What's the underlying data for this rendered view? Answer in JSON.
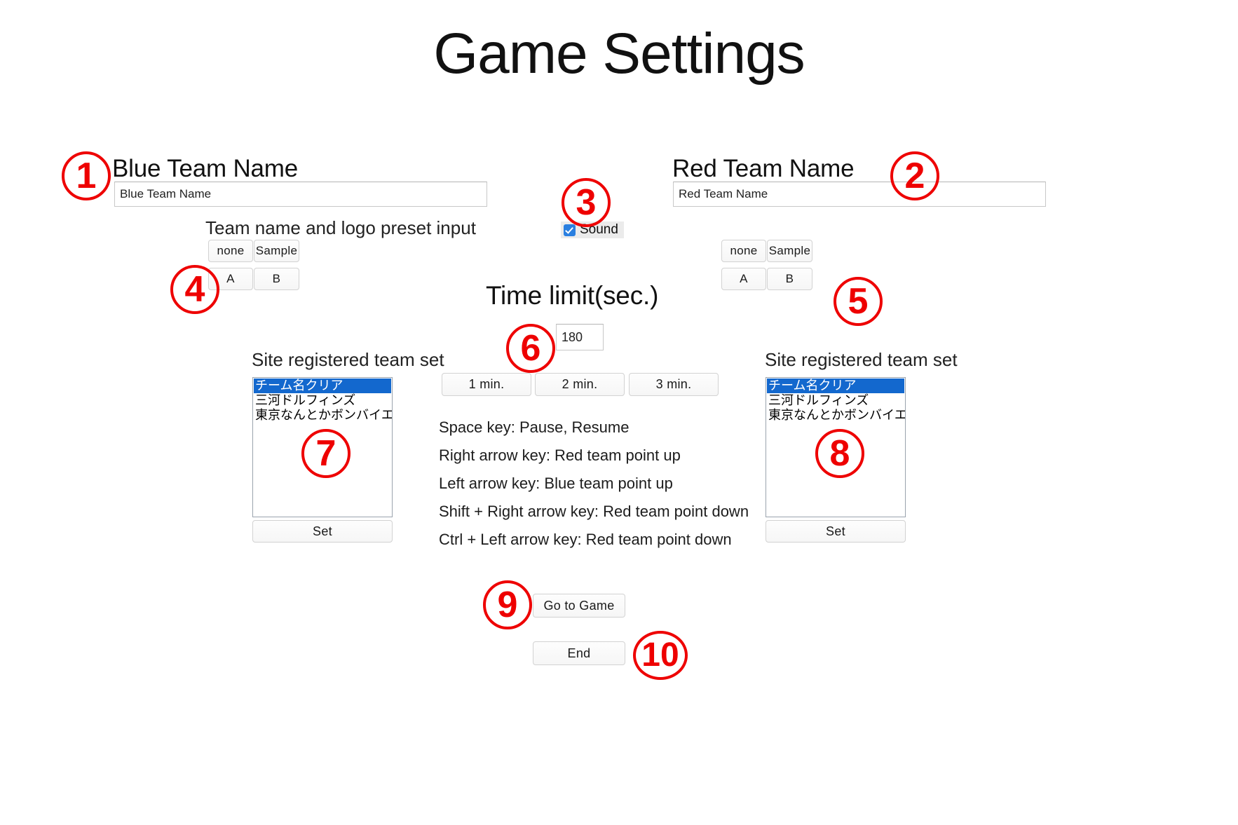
{
  "page": {
    "title": "Game Settings"
  },
  "blue_team": {
    "heading": "Blue Team Name",
    "input_value": "Blue Team Name",
    "preset_heading": "Team name and logo preset input",
    "preset_buttons": [
      "none",
      "Sample",
      "A",
      "B"
    ],
    "site_set_heading": "Site registered team set",
    "list_options": [
      "チーム名クリア",
      "三河ドルフィンズ",
      "東京なんとかボンバイエーズ"
    ],
    "list_selected_index": 0,
    "set_button": "Set"
  },
  "red_team": {
    "heading": "Red Team Name",
    "input_value": "Red Team Name",
    "preset_buttons": [
      "none",
      "Sample",
      "A",
      "B"
    ],
    "site_set_heading": "Site registered team set",
    "list_options": [
      "チーム名クリア",
      "三河ドルフィンズ",
      "東京なんとかボンバイエーズ"
    ],
    "list_selected_index": 0,
    "set_button": "Set"
  },
  "sound": {
    "label": "Sound",
    "checked": true
  },
  "time_limit": {
    "heading": "Time limit(sec.)",
    "value": "180",
    "quick_buttons": [
      "1 min.",
      "2 min.",
      "3 min."
    ]
  },
  "instructions": [
    "Space key: Pause, Resume",
    "Right arrow key: Red team point up",
    "Left arrow key: Blue team point up",
    "Shift + Right arrow key: Red team point down",
    "Ctrl + Left arrow key: Red team point down"
  ],
  "actions": {
    "go_to_game": "Go to Game",
    "end": "End"
  },
  "markers": {
    "m1": "1",
    "m2": "2",
    "m3": "3",
    "m4": "4",
    "m5": "5",
    "m6": "6",
    "m7": "7",
    "m8": "8",
    "m9": "9",
    "m10": "10"
  },
  "colors": {
    "marker_red": "#ee0000",
    "list_select_blue": "#1368ce",
    "checkbox_blue": "#2a7fe0"
  }
}
